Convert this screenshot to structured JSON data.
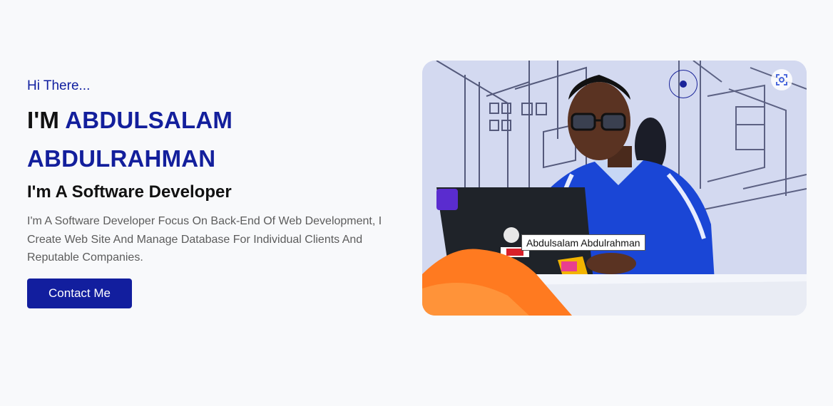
{
  "hero": {
    "greeting": "Hi There...",
    "im_prefix": "I'M",
    "name": "ABDULSALAM ABDULRAHMAN",
    "role": "I'm A Software Developer",
    "bio": "I'm A Software Developer Focus On Back-End Of Web Development, I Create Web Site And Manage Database For Individual Clients And Reputable Companies.",
    "contact_label": "Contact Me"
  },
  "photo": {
    "tooltip": "Abdulsalam Abdulrahman",
    "lens_icon": "visual-search-icon"
  },
  "colors": {
    "accent": "#131f9c",
    "button": "#121e9e",
    "background": "#f8f9fb"
  }
}
